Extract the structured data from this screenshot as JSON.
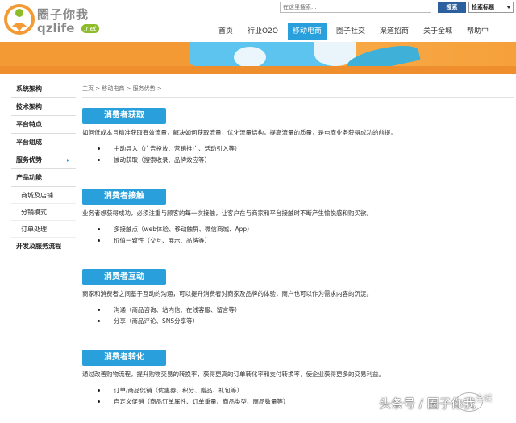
{
  "header": {
    "logo_cn": "圈子你我",
    "logo_en": "qzlife",
    "logo_net": ".net",
    "search_placeholder": "在这里搜索...",
    "search_button": "搜索",
    "search_select": "检索标题"
  },
  "nav": [
    {
      "label": "首页"
    },
    {
      "label": "行业O2O"
    },
    {
      "label": "移动电商",
      "active": true
    },
    {
      "label": "圈子社交"
    },
    {
      "label": "渠道招商"
    },
    {
      "label": "关于全城"
    },
    {
      "label": "帮助中"
    }
  ],
  "sidebar": [
    {
      "label": "系统架构"
    },
    {
      "label": "技术架构"
    },
    {
      "label": "平台特点"
    },
    {
      "label": "平台组成"
    },
    {
      "label": "服务优势",
      "active": true
    },
    {
      "label": "产品功能"
    },
    {
      "label": "商城及店铺",
      "sub": true
    },
    {
      "label": "分销模式",
      "sub": true
    },
    {
      "label": "订单处理",
      "sub": true
    },
    {
      "label": "开发及服务流程"
    }
  ],
  "breadcrumb": "主页 > 移动电商 > 服务优势 >",
  "sections": [
    {
      "title": "消费者获取",
      "desc": "如何低成本且精准获取有效流量，解决如何获取流量，优化流量结构，提高流量的质量，是电商业务获得成功的前提。",
      "items": [
        "主动导入（广告投放、营销推广、活动引入等）",
        "被动获取（搜索收录、品牌效应等）"
      ]
    },
    {
      "title": "消费者接触",
      "desc": "业务者想获得成功，必须注重与顾客的每一次接触，让客户在与商家和平台接触时不断产生愉悦感和购买欲。",
      "items": [
        "多接触点（web体验、移动触屏、微信商城、App）",
        "价值一致性（交互、展示、品牌等）"
      ]
    },
    {
      "title": "消费者互动",
      "desc": "商家和消费者之间基于互动的沟通，可以提升消费者对商家及品牌的体验，商户也可以作为需求内容的沉淀。",
      "items": [
        "沟通（商品咨询、站内信、在线客服、留言等）",
        "分享（商品评论、SNS分享等）"
      ]
    },
    {
      "title": "消费者转化",
      "desc": "通过改善购物流程，提升购物交易的转换率，获得更高的订单转化率和支付转换率，使企业获得更多的交易利益。",
      "items": [
        "订单/商品促销（优惠券、积分、赠品、礼包等）",
        "自定义促销（商品订单属性、订单重量、商品类型、商品数量等）"
      ]
    }
  ],
  "watermark": "头条号 / 圈子你我",
  "watermark_small": "全城"
}
